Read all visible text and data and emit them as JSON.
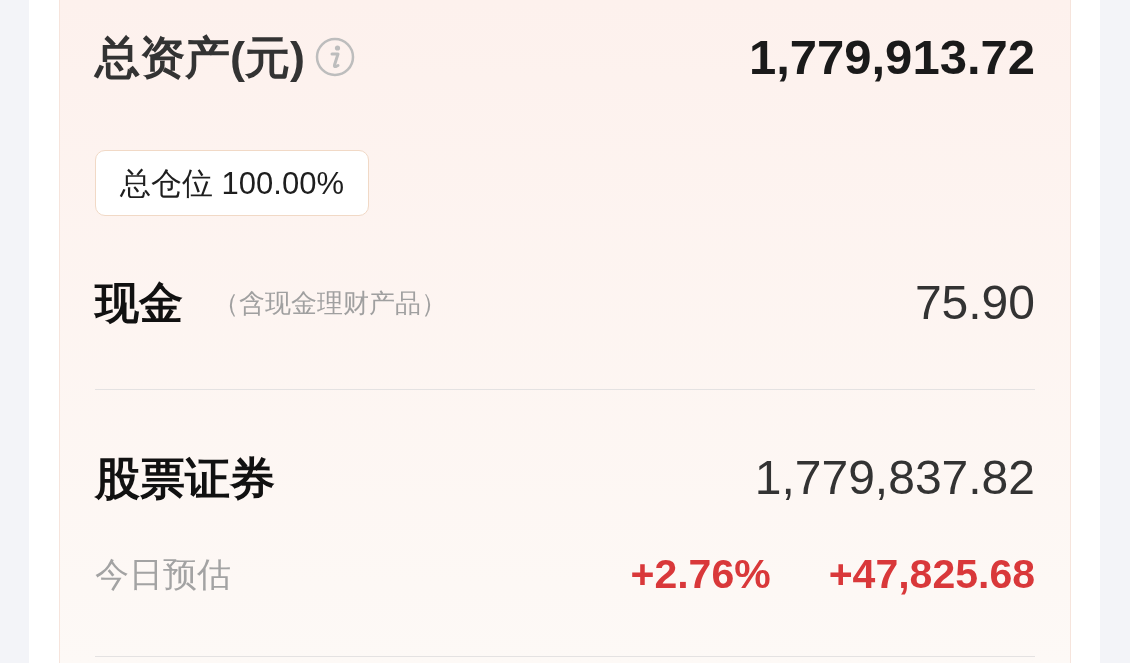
{
  "total_assets": {
    "label": "总资产(元)",
    "value": "1,779,913.72"
  },
  "position_badge": {
    "text": "总仓位 100.00%"
  },
  "sections": [
    {
      "kind": "cash",
      "title": "现金",
      "note": "（含现金理财产品）",
      "value": "75.90"
    },
    {
      "kind": "stocks",
      "title": "股票证券",
      "value": "1,779,837.82",
      "estimate": {
        "label": "今日预估",
        "percent": "+2.76%",
        "amount": "+47,825.68"
      }
    }
  ]
}
